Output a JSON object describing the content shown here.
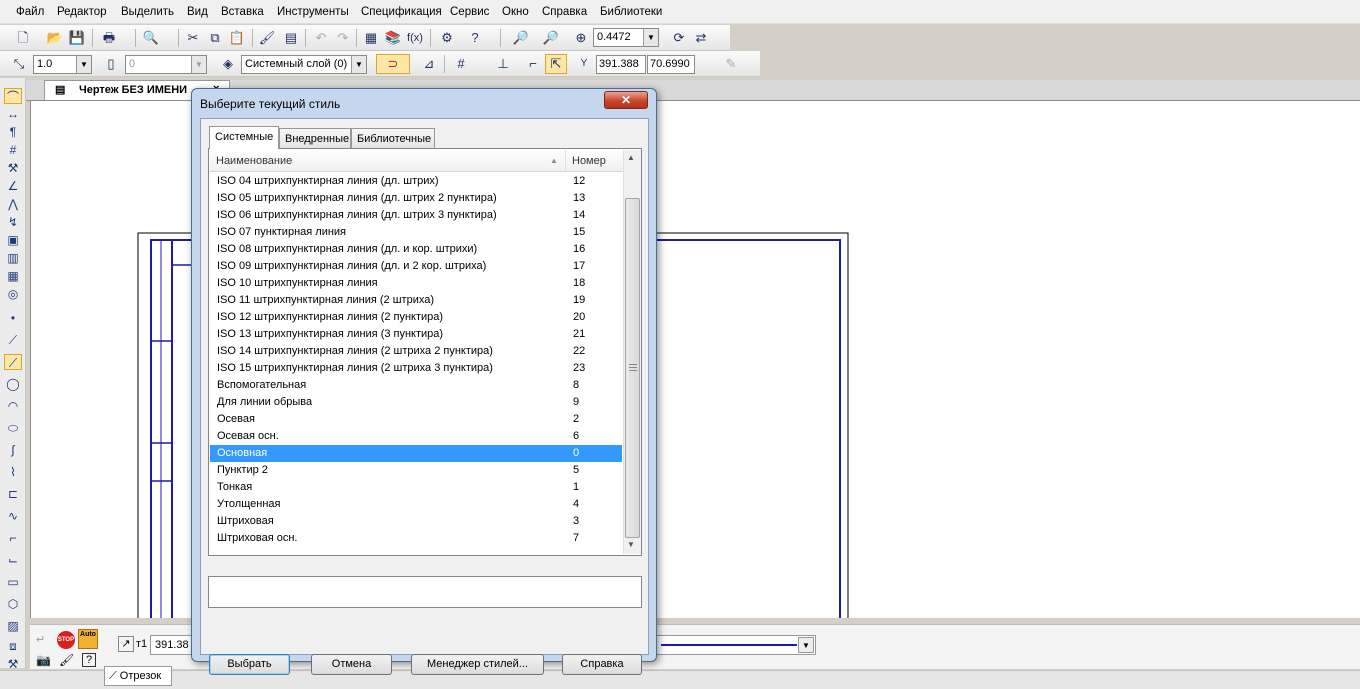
{
  "menu": [
    "Файл",
    "Редактор",
    "Выделить",
    "Вид",
    "Вставка",
    "Инструменты",
    "Спецификация",
    "Сервис",
    "Окно",
    "Справка",
    "Библиотеки"
  ],
  "toolbar": {
    "zoom_value": "0.4472",
    "line_scale": "1.0",
    "step_value": "0",
    "layer": "Системный слой (0)",
    "coord_x": "391.388",
    "coord_y": "70.6990"
  },
  "document": {
    "tab_title": "Чертеж БЕЗ ИМЕНИ",
    "close_glyph": "×"
  },
  "property_panel": {
    "t1_label": "т1",
    "t1_value": "391.38",
    "auto_label": "Auto",
    "stop_label": "STOP",
    "tab_label": "Отрезок"
  },
  "dialog": {
    "title": "Выберите текущий стиль",
    "close": "✕",
    "tabs": [
      "Системные",
      "Внедренные",
      "Библиотечные"
    ],
    "columns": {
      "name": "Наименование",
      "number": "Номер"
    },
    "rows": [
      {
        "name": "ISO 04 штрихпунктирная линия (дл. штрих)",
        "num": "12"
      },
      {
        "name": "ISO 05 штрихпунктирная линия (дл. штрих 2 пунктира)",
        "num": "13"
      },
      {
        "name": "ISO 06 штрихпунктирная линия (дл. штрих 3 пунктира)",
        "num": "14"
      },
      {
        "name": "ISO 07 пунктирная линия",
        "num": "15"
      },
      {
        "name": "ISO 08 штрихпунктирная линия (дл. и кор. штрихи)",
        "num": "16"
      },
      {
        "name": "ISO 09 штрихпунктирная линия (дл. и 2 кор. штриха)",
        "num": "17"
      },
      {
        "name": "ISO 10 штрихпунктирная линия",
        "num": "18"
      },
      {
        "name": "ISO 11 штрихпунктирная линия (2 штриха)",
        "num": "19"
      },
      {
        "name": "ISO 12 штрихпунктирная линия (2 пунктира)",
        "num": "20"
      },
      {
        "name": "ISO 13 штрихпунктирная линия (3 пунктира)",
        "num": "21"
      },
      {
        "name": "ISO 14 штрихпунктирная линия (2 штриха 2 пунктира)",
        "num": "22"
      },
      {
        "name": "ISO 15 штрихпунктирная линия (2 штриха 3 пунктира)",
        "num": "23"
      },
      {
        "name": "Вспомогательная",
        "num": "8"
      },
      {
        "name": "Для линии обрыва",
        "num": "9"
      },
      {
        "name": "Осевая",
        "num": "2"
      },
      {
        "name": "Осевая осн.",
        "num": "6"
      },
      {
        "name": "Основная",
        "num": "0"
      },
      {
        "name": "Пунктир 2",
        "num": "5"
      },
      {
        "name": "Тонкая",
        "num": "1"
      },
      {
        "name": "Утолщенная",
        "num": "4"
      },
      {
        "name": "Штриховая",
        "num": "3"
      },
      {
        "name": "Штриховая осн.",
        "num": "7"
      }
    ],
    "selected_index": 16,
    "buttons": {
      "select": "Выбрать",
      "cancel": "Отмена",
      "manager": "Менеджер стилей...",
      "help": "Справка"
    }
  },
  "colors": {
    "frame": "#1c1ca8",
    "selection": "#3399ff",
    "dialog_frame": "#c4d7ec"
  }
}
